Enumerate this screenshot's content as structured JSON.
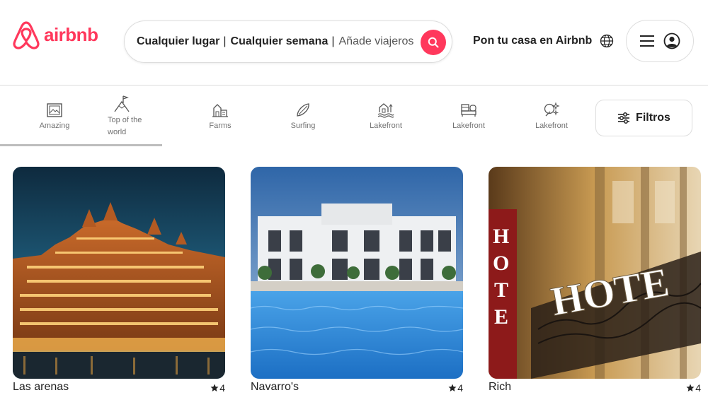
{
  "brand": {
    "name": "airbnb",
    "color": "#ff385c"
  },
  "search": {
    "where": "Cualquier lugar",
    "when": "Cualquier semana",
    "separator": "|",
    "guests": "Añade viajeros",
    "icon": "search-icon"
  },
  "header": {
    "host_link": "Pon tu casa en Airbnb",
    "globe_icon": "globe-icon",
    "menu_icon": "hamburger-menu-icon",
    "user_icon": "user-avatar-icon"
  },
  "categories": [
    {
      "label": "Amazing",
      "icon": "framed-picture-icon"
    },
    {
      "label": "Top of the world",
      "line1": "Top of the",
      "line2": "world",
      "icon": "mountain-flag-icon",
      "selected": true
    },
    {
      "label": "Farms",
      "icon": "barn-icon"
    },
    {
      "label": "Surfing",
      "icon": "surfboard-icon"
    },
    {
      "label": "Lakefront",
      "icon": "lake-house-icon"
    },
    {
      "label": "Lakefront",
      "icon": "bed-icon"
    },
    {
      "label": "Lakefront",
      "icon": "magic-sparkle-icon"
    }
  ],
  "filters": {
    "label": "Filtros",
    "icon": "sliders-icon"
  },
  "listings": [
    {
      "title": "Las arenas",
      "rating": "4",
      "image": "illuminated-grand-hotel-at-dusk"
    },
    {
      "title": "Navarro's",
      "rating": "4",
      "image": "white-hotel-with-pool"
    },
    {
      "title": "Rich",
      "rating": "4",
      "image": "hotel-sign-facade"
    }
  ]
}
